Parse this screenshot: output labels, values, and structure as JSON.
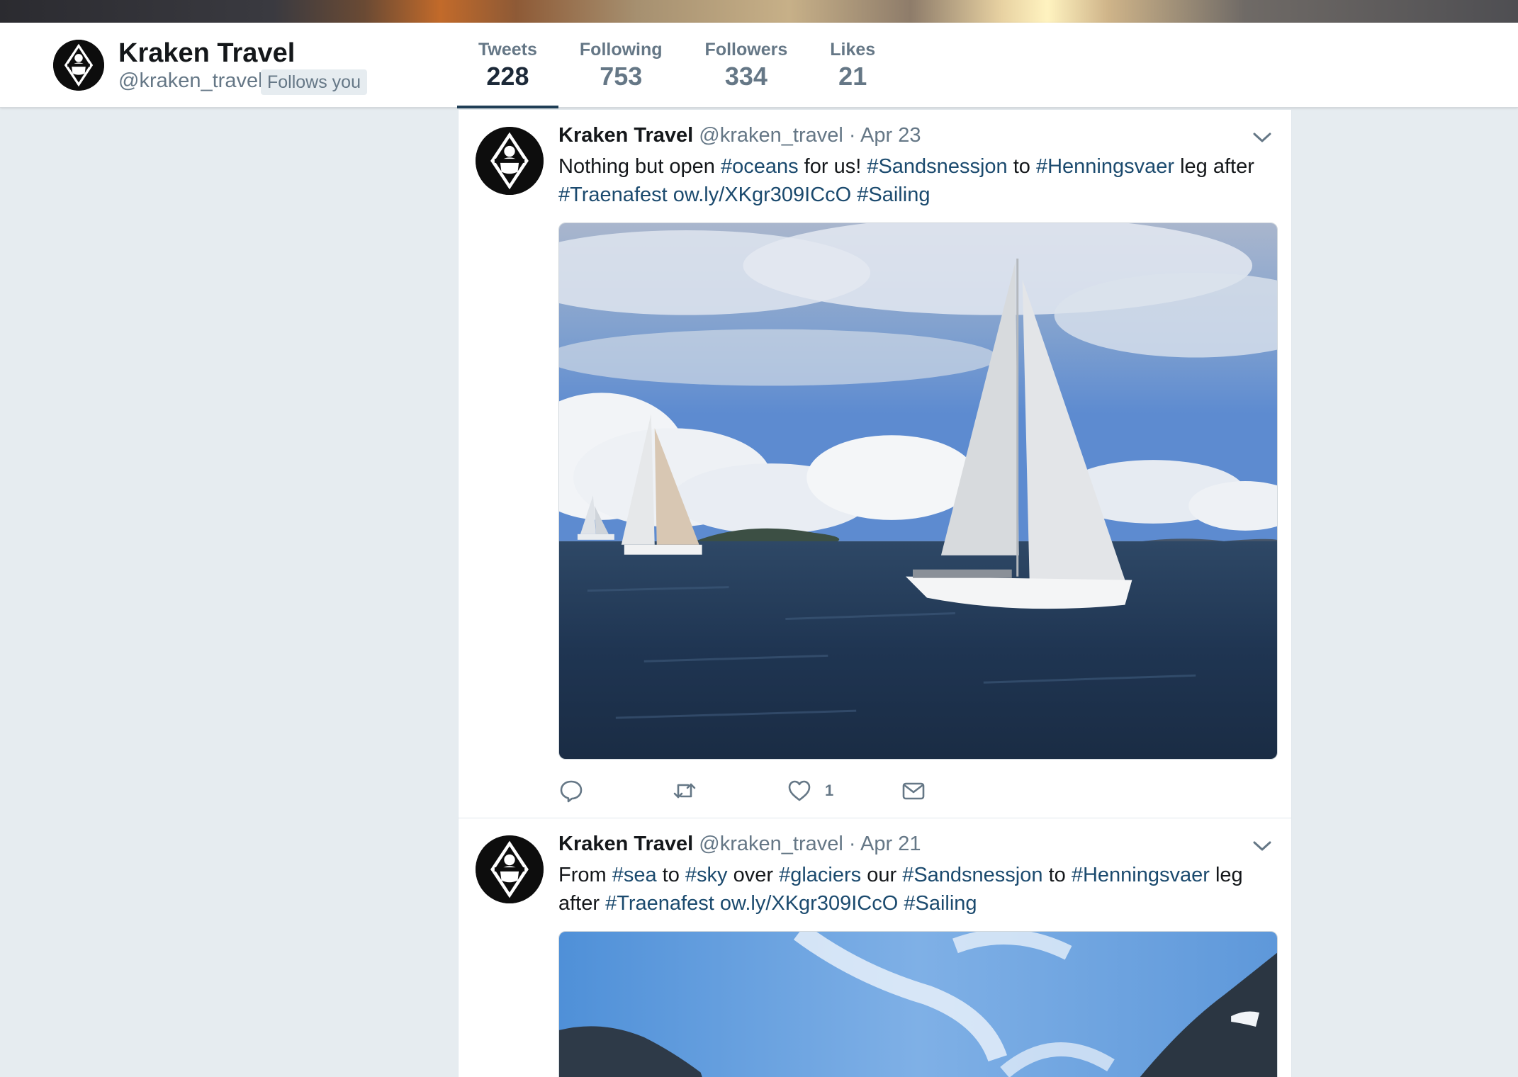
{
  "profile": {
    "name": "Kraken Travel",
    "handle": "@kraken_travel",
    "follows_badge": "Follows you",
    "stats": [
      {
        "label": "Tweets",
        "value": "228"
      },
      {
        "label": "Following",
        "value": "753"
      },
      {
        "label": "Followers",
        "value": "334"
      },
      {
        "label": "Likes",
        "value": "21"
      }
    ]
  },
  "tweets": [
    {
      "name": "Kraken Travel",
      "handle": "@kraken_travel",
      "dot": "·",
      "date": "Apr 23",
      "text_parts": [
        {
          "t": "Nothing but open "
        },
        {
          "t": "#oceans",
          "link": true
        },
        {
          "t": " for us! "
        },
        {
          "t": "#Sandsnessjon",
          "link": true
        },
        {
          "t": " to "
        },
        {
          "t": "#Henningsvaer",
          "link": true
        },
        {
          "t": " leg after "
        },
        {
          "t": "#Traenafest",
          "link": true
        },
        {
          "t": " "
        },
        {
          "t": "ow.ly/XKgr309ICcO",
          "link": true
        },
        {
          "t": " "
        },
        {
          "t": "#Sailing",
          "link": true
        }
      ],
      "like_count": "1",
      "media": "sailboats-photo"
    },
    {
      "name": "Kraken Travel",
      "handle": "@kraken_travel",
      "dot": "·",
      "date": "Apr 21",
      "text_parts": [
        {
          "t": "From "
        },
        {
          "t": "#sea",
          "link": true
        },
        {
          "t": " to "
        },
        {
          "t": "#sky",
          "link": true
        },
        {
          "t": " over "
        },
        {
          "t": "#glaciers",
          "link": true
        },
        {
          "t": " our "
        },
        {
          "t": "#Sandsnessjon",
          "link": true
        },
        {
          "t": " to "
        },
        {
          "t": "#Henningsvaer",
          "link": true
        },
        {
          "t": " leg after "
        },
        {
          "t": "#Traenafest",
          "link": true
        },
        {
          "t": " "
        },
        {
          "t": "ow.ly/XKgr309ICcO",
          "link": true
        },
        {
          "t": " "
        },
        {
          "t": "#Sailing",
          "link": true
        }
      ],
      "media": "mountains-photo"
    }
  ],
  "colors": {
    "link": "#1b4a6e",
    "muted": "#657786",
    "active_tab_underline": "#1f3e56",
    "background": "#e6ecf0"
  },
  "icons": [
    "reply-icon",
    "retweet-icon",
    "like-icon",
    "direct-message-icon",
    "chevron-down-icon",
    "kraken-logo"
  ]
}
